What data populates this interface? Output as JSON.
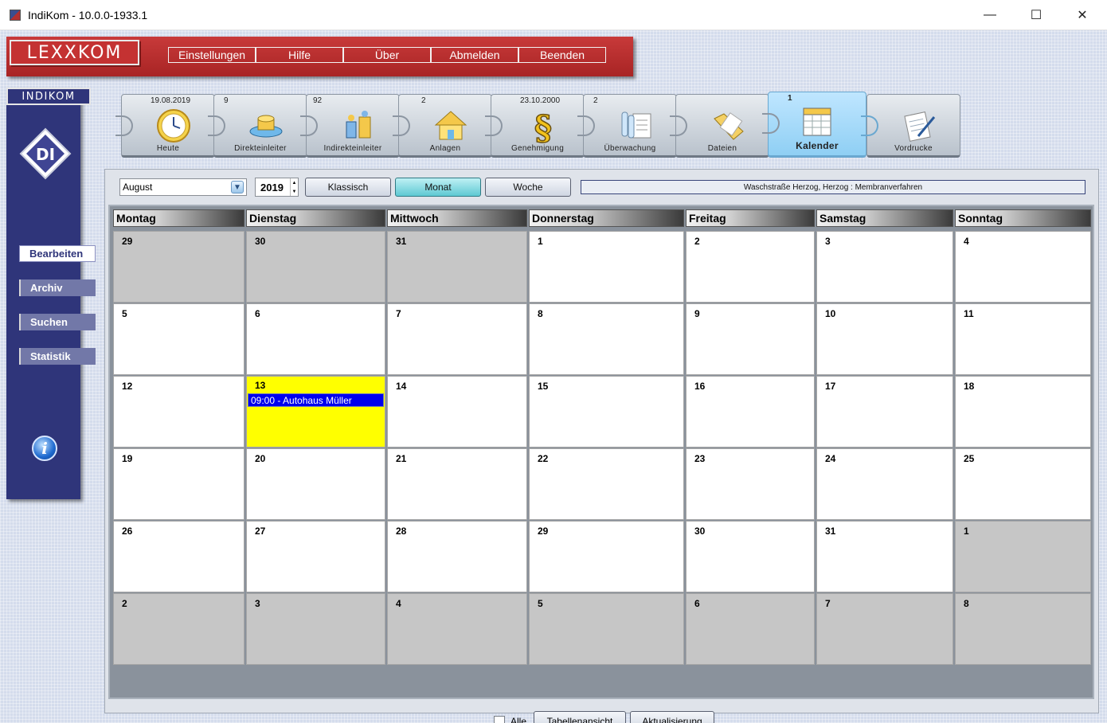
{
  "window": {
    "title": "IndiKom  -  10.0.0-1933.1",
    "minimize": "—",
    "maximize": "☐",
    "close": "✕"
  },
  "brand": {
    "lexxkom": "LEXXKOM",
    "indikom": "INDIKOM",
    "di": "DI"
  },
  "menu": [
    "Einstellungen",
    "Hilfe",
    "Über",
    "Abmelden",
    "Beenden"
  ],
  "side_nav": [
    "Bearbeiten",
    "Archiv",
    "Suchen",
    "Statistik"
  ],
  "side_nav_active": "Bearbeiten",
  "modules": [
    {
      "label": "Heute",
      "top": "19.08.2019",
      "icon": "clock-icon"
    },
    {
      "label": "Direkteinleiter",
      "top": "9",
      "icon": "direct-discharger-icon"
    },
    {
      "label": "Indirekteinleiter",
      "top": "92",
      "icon": "indirect-discharger-icon"
    },
    {
      "label": "Anlagen",
      "top": "2",
      "icon": "house-icon"
    },
    {
      "label": "Genehmigung",
      "top": "23.10.2000",
      "icon": "paragraph-icon"
    },
    {
      "label": "Überwachung",
      "top": "2",
      "icon": "test-tubes-icon"
    },
    {
      "label": "Dateien",
      "top": "",
      "icon": "folder-icon"
    },
    {
      "label": "Kalender",
      "top": "1",
      "icon": "calendar-icon"
    },
    {
      "label": "Vordrucke",
      "top": "",
      "icon": "form-pen-icon"
    }
  ],
  "active_module": "Kalender",
  "calendar_controls": {
    "month": "August",
    "year": "2019",
    "views": [
      "Klassisch",
      "Monat",
      "Woche"
    ],
    "active_view": "Monat",
    "project": "Waschstraße Herzog, Herzog : Membranverfahren"
  },
  "weekdays": [
    "Montag",
    "Dienstag",
    "Mittwoch",
    "Donnerstag",
    "Freitag",
    "Samstag",
    "Sonntag"
  ],
  "weeks": [
    [
      {
        "d": "29",
        "g": true
      },
      {
        "d": "30",
        "g": true
      },
      {
        "d": "31",
        "g": true
      },
      {
        "d": "1"
      },
      {
        "d": "2"
      },
      {
        "d": "3"
      },
      {
        "d": "4"
      }
    ],
    [
      {
        "d": "5"
      },
      {
        "d": "6"
      },
      {
        "d": "7"
      },
      {
        "d": "8"
      },
      {
        "d": "9"
      },
      {
        "d": "10"
      },
      {
        "d": "11"
      }
    ],
    [
      {
        "d": "12"
      },
      {
        "d": "13",
        "today": true,
        "event": "09:00 - Autohaus Müller"
      },
      {
        "d": "14"
      },
      {
        "d": "15"
      },
      {
        "d": "16"
      },
      {
        "d": "17"
      },
      {
        "d": "18"
      }
    ],
    [
      {
        "d": "19"
      },
      {
        "d": "20"
      },
      {
        "d": "21"
      },
      {
        "d": "22"
      },
      {
        "d": "23"
      },
      {
        "d": "24"
      },
      {
        "d": "25"
      }
    ],
    [
      {
        "d": "26"
      },
      {
        "d": "27"
      },
      {
        "d": "28"
      },
      {
        "d": "29"
      },
      {
        "d": "30"
      },
      {
        "d": "31"
      },
      {
        "d": "1",
        "g": true
      }
    ],
    [
      {
        "d": "2",
        "g": true
      },
      {
        "d": "3",
        "g": true
      },
      {
        "d": "4",
        "g": true
      },
      {
        "d": "5",
        "g": true
      },
      {
        "d": "6",
        "g": true
      },
      {
        "d": "7",
        "g": true
      },
      {
        "d": "8",
        "g": true
      }
    ]
  ],
  "bottom": {
    "all_label": "Alle",
    "all_checked": false,
    "table_view": "Tabellenansicht",
    "refresh": "Aktualisierung"
  },
  "colors": {
    "today": "#ffff00",
    "event": "#0000ee",
    "other_month": "#c6c6c6",
    "brand_red": "#c43232",
    "brand_blue": "#2f357a"
  }
}
